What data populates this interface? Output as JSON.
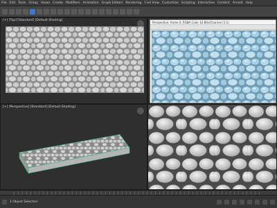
{
  "menubar": {
    "items": [
      "File",
      "Edit",
      "Tools",
      "Group",
      "Views",
      "Create",
      "Modifiers",
      "Animation",
      "Graph Editors",
      "Rendering",
      "Civil View",
      "Customize",
      "Scripting",
      "Interactive",
      "Content",
      "Arnold",
      "Help"
    ]
  },
  "viewports": {
    "top_left": {
      "label": "[+] [Top] [Standard] [Default Shading]"
    },
    "top_right": {
      "render_title": "Perspective, frame 0, RGBA Color 16 Bits/Channel (1:1)"
    },
    "bottom_left": {
      "label": "[+] [Perspective] [Standard] [Default Shading]"
    },
    "bottom_right": {
      "label": ""
    }
  },
  "status": {
    "text": "1 Object Selected"
  },
  "colors": {
    "accent": "#3b79c9",
    "viewport_bg": "#2f2f2f",
    "stone": "#cfcfcf",
    "water": "#a9cfe4",
    "highlight": "#3ab07a"
  }
}
